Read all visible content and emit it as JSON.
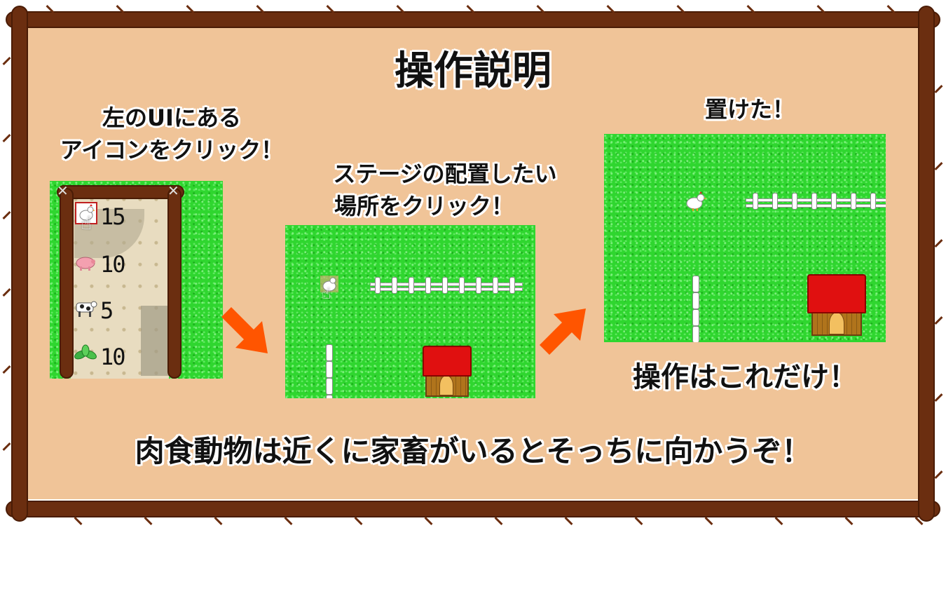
{
  "title": "操作説明",
  "step1": {
    "caption_line1": "左のUIにある",
    "caption_line2": "アイコンをクリック！",
    "items": [
      {
        "icon": "chicken-icon",
        "count": "15"
      },
      {
        "icon": "pig-icon",
        "count": "10"
      },
      {
        "icon": "cow-icon",
        "count": "5"
      },
      {
        "icon": "plant-icon",
        "count": "10"
      }
    ]
  },
  "step2": {
    "caption_line1": "ステージの配置したい",
    "caption_line2": "場所をクリック！"
  },
  "step3": {
    "caption": "置けた！",
    "caption_after": "操作はこれだけ！"
  },
  "footer": "肉食動物は近くに家畜がいるとそっちに向かうぞ！",
  "colors": {
    "board": "#f0c498",
    "log": "#6b2e10",
    "grass": "#2fd62f",
    "arrow": "#ff5500",
    "roof": "#e01010"
  }
}
